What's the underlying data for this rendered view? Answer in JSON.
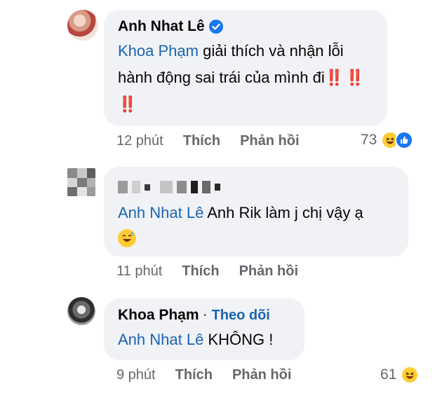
{
  "comments": [
    {
      "author": "Anh Nhat Lê",
      "verified": true,
      "mention": "Khoa Phạm",
      "text_after_mention": " giải thích và nhận lỗi hành động sai trái của mình đi",
      "marks": "‼️ ‼️ ‼️",
      "time": "12 phút",
      "like_label": "Thích",
      "reply_label": "Phản hồi",
      "reaction_count": "73",
      "reactions": [
        "laugh-icon",
        "like-icon"
      ]
    },
    {
      "author_blurred": true,
      "mention": "Anh Nhat Lê",
      "text_after_mention": " Anh Rik làm j chị vậy ạ",
      "emoji": "sweat-smile-emoji",
      "time": "11 phút",
      "like_label": "Thích",
      "reply_label": "Phản hồi"
    },
    {
      "author": "Khoa Phạm",
      "separator": "·",
      "follow_label": "Theo dõi",
      "mention": "Anh Nhat Lê",
      "text_after_mention": " KHÔNG !",
      "time": "9 phút",
      "like_label": "Thích",
      "reply_label": "Phản hồi",
      "reaction_count": "61",
      "reactions": [
        "laugh-icon"
      ]
    }
  ],
  "colors": {
    "bubble": "#f0f2f5",
    "mention": "#1a64b4",
    "meta": "#65676b",
    "verified": "#1877f2",
    "bang": "#e0241f"
  }
}
